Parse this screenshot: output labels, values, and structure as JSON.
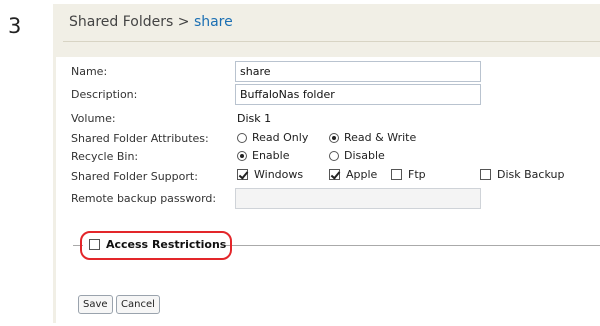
{
  "step_number": "3",
  "breadcrumb": {
    "parent": "Shared Folders",
    "separator": " > ",
    "current": "share"
  },
  "form": {
    "name_label": "Name:",
    "name_value": "share",
    "description_label": "Description:",
    "description_value": "BuffaloNas folder",
    "volume_label": "Volume:",
    "volume_value": "Disk 1",
    "attributes_label": "Shared Folder Attributes:",
    "attributes_options": [
      {
        "label": "Read Only",
        "checked": false
      },
      {
        "label": "Read & Write",
        "checked": true
      }
    ],
    "recycle_label": "Recycle Bin:",
    "recycle_options": [
      {
        "label": "Enable",
        "checked": true
      },
      {
        "label": "Disable",
        "checked": false
      }
    ],
    "support_label": "Shared Folder Support:",
    "support_options": [
      {
        "label": "Windows",
        "checked": true
      },
      {
        "label": "Apple",
        "checked": true
      },
      {
        "label": "Ftp",
        "checked": false
      },
      {
        "label": "Disk Backup",
        "checked": false
      }
    ],
    "remote_backup_label": "Remote backup password:",
    "remote_backup_value": ""
  },
  "access_restrictions": {
    "label": "Access Restrictions",
    "checked": false
  },
  "buttons": {
    "save": "Save",
    "cancel": "Cancel"
  },
  "colors": {
    "panel_background": "#f1efe6",
    "breadcrumb_link": "#1b6fb3",
    "highlight_oval": "#e3262a"
  }
}
